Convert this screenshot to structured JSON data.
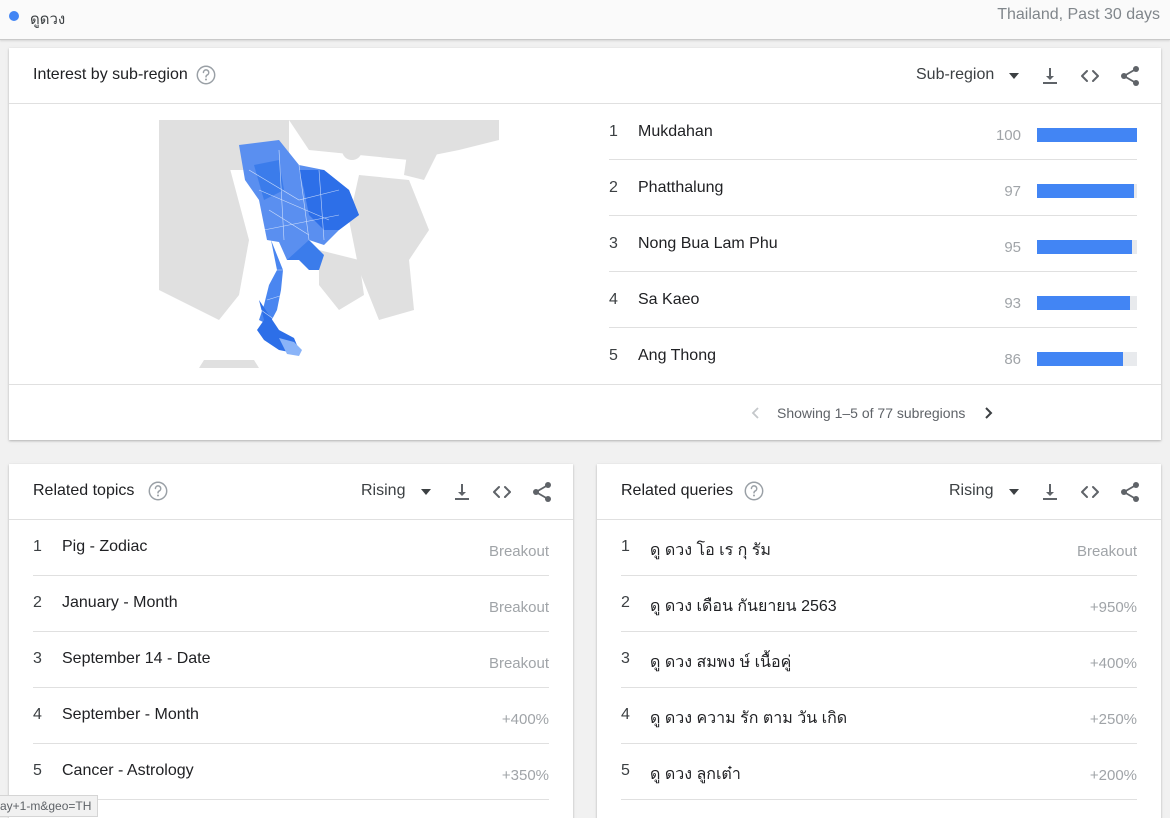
{
  "topbar": {
    "term": "ดูดวง",
    "range": "Thailand, Past 30 days",
    "term_color": "#4285f4"
  },
  "subregion": {
    "title": "Interest by sub-region",
    "select": "Sub-region",
    "bar_color": "#4285f4",
    "rows": [
      {
        "rank": "1",
        "name": "Mukdahan",
        "value": 100
      },
      {
        "rank": "2",
        "name": "Phatthalung",
        "value": 97
      },
      {
        "rank": "3",
        "name": "Nong Bua Lam Phu",
        "value": 95
      },
      {
        "rank": "4",
        "name": "Sa Kaeo",
        "value": 93
      },
      {
        "rank": "5",
        "name": "Ang Thong",
        "value": 86
      }
    ],
    "pager": "Showing 1–5 of 77 subregions"
  },
  "topics": {
    "title": "Related topics",
    "select": "Rising",
    "rows": [
      {
        "rank": "1",
        "label": "Pig - Zodiac",
        "value": "Breakout"
      },
      {
        "rank": "2",
        "label": "January - Month",
        "value": "Breakout"
      },
      {
        "rank": "3",
        "label": "September 14 - Date",
        "value": "Breakout"
      },
      {
        "rank": "4",
        "label": "September - Month",
        "value": "+400%"
      },
      {
        "rank": "5",
        "label": "Cancer - Astrology",
        "value": "+350%"
      }
    ]
  },
  "queries": {
    "title": "Related queries",
    "select": "Rising",
    "rows": [
      {
        "rank": "1",
        "label": "ดู ดวง โอ เร กุ รัม",
        "value": "Breakout"
      },
      {
        "rank": "2",
        "label": "ดู ดวง เดือน กันยายน 2563",
        "value": "+950%"
      },
      {
        "rank": "3",
        "label": "ดู ดวง สมพง ษ์ เนื้อคู่",
        "value": "+400%"
      },
      {
        "rank": "4",
        "label": "ดู ดวง ความ รัก ตาม วัน เกิด",
        "value": "+250%"
      },
      {
        "rank": "5",
        "label": "ดู ดวง ลูกเต๋า",
        "value": "+200%"
      }
    ]
  },
  "status_url": "ay+1-m&geo=TH",
  "icons": [
    "help-icon",
    "caret-down-icon",
    "download-icon",
    "embed-icon",
    "share-icon",
    "chevron-left-icon",
    "chevron-right-icon"
  ]
}
